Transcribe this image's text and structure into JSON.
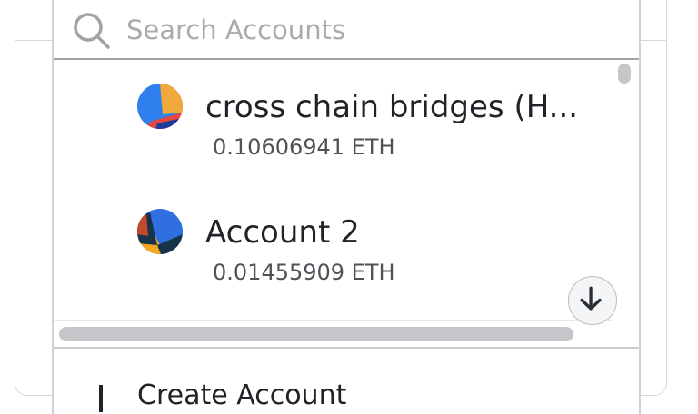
{
  "search": {
    "placeholder": "Search Accounts",
    "icon": "search-icon"
  },
  "accounts": [
    {
      "name": "cross chain bridges (H...",
      "balance": "0.10606941 ETH",
      "avatar_colors": [
        "#2f80ed",
        "#f2a93b",
        "#e8453c",
        "#1b3b9e"
      ]
    },
    {
      "name": "Account 2",
      "balance": "0.01455909 ETH",
      "avatar_colors": [
        "#2f6fe0",
        "#f5a623",
        "#16334a",
        "#c44a2b"
      ]
    }
  ],
  "scroll_down_icon": "arrow-down-icon",
  "create_account": {
    "label": "Create Account"
  },
  "colors": {
    "text_primary": "#1f2327",
    "text_secondary": "#4f5358",
    "placeholder": "#a8abaf",
    "border": "#cfd3d7"
  }
}
